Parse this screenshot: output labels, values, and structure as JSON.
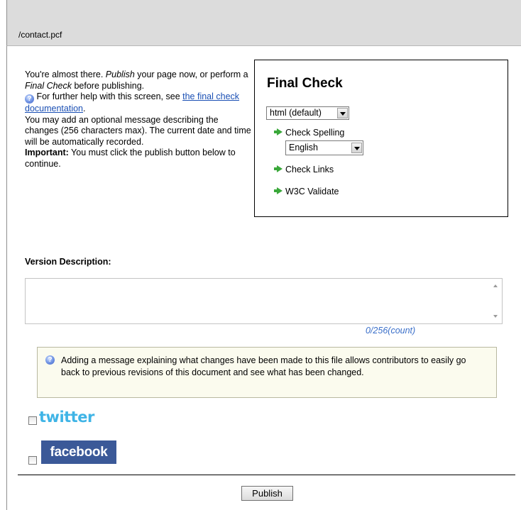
{
  "file_path": "/contact.pcf",
  "intro": {
    "line1_prefix": "You're almost there. ",
    "publish_word": "Publish",
    "line1_suffix": " your page now, or perform a ",
    "final_check_word": "Final Check",
    "line1_end": " before publishing.",
    "help_prefix": " For further help with this screen, see ",
    "help_link": "the final check documentation",
    "help_suffix": ".",
    "optional_message": "You may add an optional message describing the changes (256 characters max). The current date and time will be automatically recorded.",
    "important_label": "Important:",
    "important_text": " You must click the publish button below to continue."
  },
  "final_check": {
    "title": "Final Check",
    "format_select": "html (default)",
    "check_spelling": "Check Spelling",
    "language_select": "English",
    "check_links": "Check Links",
    "w3c_validate": "W3C Validate"
  },
  "version": {
    "label": "Version Description:",
    "value": "",
    "counter": "0/256(count)"
  },
  "info_message": "Adding a message explaining what changes have been made to this file allows contributors to easily go back to previous revisions of this document and see what has been changed.",
  "social": {
    "twitter": "twitter",
    "facebook": "facebook"
  },
  "publish_button": "Publish",
  "colors": {
    "link": "#1a4fb4",
    "counter": "#3a6fc9",
    "twitter": "#3fb4e6",
    "facebook": "#3b5998",
    "arrow": "#3aa83a"
  }
}
